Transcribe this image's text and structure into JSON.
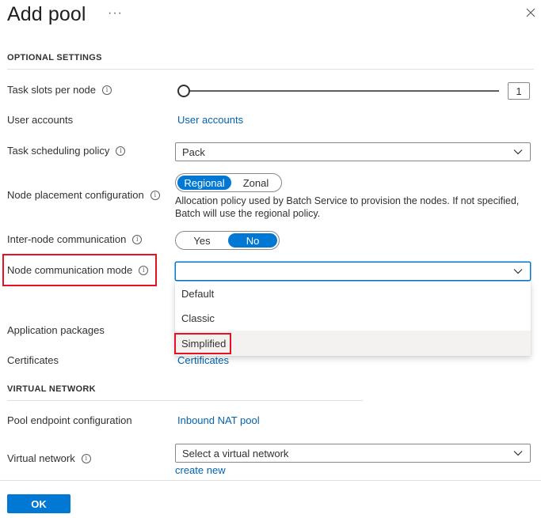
{
  "header": {
    "title": "Add pool",
    "more_label": "···"
  },
  "optional_settings": {
    "section_title": "OPTIONAL SETTINGS",
    "task_slots": {
      "label": "Task slots per node",
      "value": "1",
      "slider_fraction": 0.0
    },
    "user_accounts": {
      "label": "User accounts",
      "link": "User accounts"
    },
    "task_scheduling": {
      "label": "Task scheduling policy",
      "value": "Pack"
    },
    "node_placement": {
      "label": "Node placement configuration",
      "options": [
        "Regional",
        "Zonal"
      ],
      "selected": "Regional",
      "description_line1": "Allocation policy used by Batch Service to provision the nodes. If not specified,",
      "description_line2": "Batch will use the regional policy."
    },
    "inter_node": {
      "label": "Inter-node communication",
      "options": [
        "Yes",
        "No"
      ],
      "selected": "No"
    },
    "node_comm_mode": {
      "label": "Node communication mode",
      "value": "",
      "options": [
        "Default",
        "Classic",
        "Simplified"
      ],
      "highlighted": "Simplified"
    },
    "application_packages": {
      "label": "Application packages"
    },
    "certificates": {
      "label": "Certificates",
      "link": "Certificates"
    }
  },
  "virtual_network": {
    "section_title": "VIRTUAL NETWORK",
    "pool_endpoint": {
      "label": "Pool endpoint configuration",
      "link": "Inbound NAT pool"
    },
    "vnet": {
      "label": "Virtual network",
      "placeholder": "Select a virtual network",
      "create_link": "create new"
    }
  },
  "footer": {
    "ok_label": "OK"
  },
  "colors": {
    "accent": "#0078d4",
    "link": "#0063b1",
    "callout": "#e81123",
    "text": "#323130"
  }
}
